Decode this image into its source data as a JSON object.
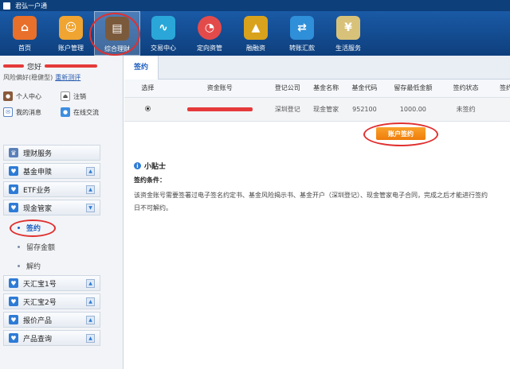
{
  "window": {
    "title": "君弘一户通"
  },
  "toolbar": {
    "items": [
      {
        "label": "首页",
        "icon": "home-icon",
        "color": "#e8702a"
      },
      {
        "label": "账户管理",
        "icon": "account-icon",
        "color": "#f0a431"
      },
      {
        "label": "综合理财",
        "icon": "wallet-icon",
        "color": "#7b5a3c"
      },
      {
        "label": "交易中心",
        "icon": "trend-icon",
        "color": "#2aa7d8"
      },
      {
        "label": "定向资管",
        "icon": "pie-icon",
        "color": "#e34b4b"
      },
      {
        "label": "融融资",
        "icon": "pyramid-icon",
        "color": "#d9a21c"
      },
      {
        "label": "转账汇款",
        "icon": "transfer-icon",
        "color": "#2f8fd8"
      },
      {
        "label": "生活服务",
        "icon": "shopping-icon",
        "color": "#d8c27a"
      }
    ],
    "active_index": 2
  },
  "user": {
    "greeting": "您好",
    "risk_label": "风险偏好(稳健型)",
    "retest_link": "重新测评"
  },
  "quick_links": [
    {
      "label": "个人中心",
      "icon": "person-icon"
    },
    {
      "label": "注销",
      "icon": "logout-icon"
    },
    {
      "label": "我的消息",
      "icon": "mail-icon"
    },
    {
      "label": "在线交流",
      "icon": "chat-icon"
    }
  ],
  "menu": {
    "top": "理财服务",
    "groups": [
      {
        "label": "基金申赎"
      },
      {
        "label": "ETF业务"
      },
      {
        "label": "现金管家"
      }
    ],
    "sub_items": [
      {
        "label": "签约"
      },
      {
        "label": "留存金额"
      },
      {
        "label": "解约"
      }
    ],
    "bottom_groups": [
      {
        "label": "天汇宝1号"
      },
      {
        "label": "天汇宝2号"
      },
      {
        "label": "报价产品"
      },
      {
        "label": "产品查询"
      }
    ]
  },
  "main": {
    "tab": "签约",
    "table": {
      "headers": [
        "选择",
        "资金账号",
        "登记公司",
        "基金名称",
        "基金代码",
        "留存最低金额",
        "签约状态",
        "签约"
      ],
      "row": [
        "",
        "",
        "深圳登记",
        "现金管家",
        "952100",
        "1000.00",
        "未签约",
        ""
      ]
    },
    "sign_button": "账户签约",
    "tips": {
      "title": "小贴士",
      "subtitle": "签约条件：",
      "line1": "该资金账号需要签署过电子签名约定书、基金风险揭示书、基金开户（深圳登记）、现金管家电子合同，完成之后才能进行签约",
      "line2": "日不可解约。"
    }
  },
  "colors": {
    "accent": "#1d5fbf",
    "button": "#ef7d0a",
    "annotation": "#e03030"
  }
}
